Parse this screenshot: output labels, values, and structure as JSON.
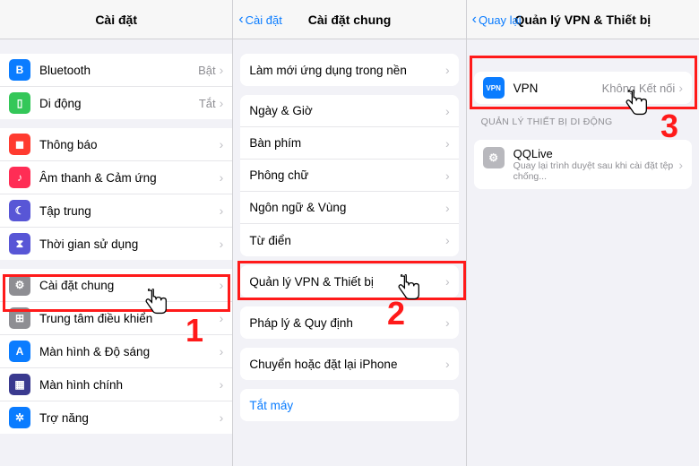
{
  "col1": {
    "title": "Cài đặt",
    "groupA": [
      {
        "name": "bluetooth",
        "label": "Bluetooth",
        "value": "Bật",
        "iconClass": "ic-bt",
        "glyph": "B"
      },
      {
        "name": "cellular",
        "label": "Di động",
        "value": "Tắt",
        "iconClass": "ic-cell",
        "glyph": "▯"
      }
    ],
    "groupB": [
      {
        "name": "notifications",
        "label": "Thông báo",
        "iconClass": "ic-notif",
        "glyph": "◼"
      },
      {
        "name": "sounds",
        "label": "Âm thanh & Cảm ứng",
        "iconClass": "ic-sound",
        "glyph": "♪"
      },
      {
        "name": "focus",
        "label": "Tập trung",
        "iconClass": "ic-focus",
        "glyph": "☾"
      },
      {
        "name": "screentime",
        "label": "Thời gian sử dụng",
        "iconClass": "ic-screentime",
        "glyph": "⧗"
      }
    ],
    "groupC": [
      {
        "name": "general",
        "label": "Cài đặt chung",
        "iconClass": "ic-general",
        "glyph": "⚙"
      },
      {
        "name": "controlcenter",
        "label": "Trung tâm điều khiển",
        "iconClass": "ic-control",
        "glyph": "⊞"
      },
      {
        "name": "display",
        "label": "Màn hình & Độ sáng",
        "iconClass": "ic-display",
        "glyph": "A"
      },
      {
        "name": "homescreen",
        "label": "Màn hình chính",
        "iconClass": "ic-home",
        "glyph": "▦"
      },
      {
        "name": "accessibility",
        "label": "Trợ năng",
        "iconClass": "ic-access",
        "glyph": "✲"
      }
    ]
  },
  "col2": {
    "back": "Cài đặt",
    "title": "Cài đặt chung",
    "g1": [
      {
        "label": "Làm mới ứng dụng trong nền"
      }
    ],
    "g2": [
      {
        "label": "Ngày & Giờ"
      },
      {
        "label": "Bàn phím"
      },
      {
        "label": "Phông chữ"
      },
      {
        "label": "Ngôn ngữ & Vùng"
      },
      {
        "label": "Từ điển"
      }
    ],
    "g3": [
      {
        "label": "Quản lý VPN & Thiết bị"
      }
    ],
    "g4": [
      {
        "label": "Pháp lý & Quy định"
      }
    ],
    "g5": [
      {
        "label": "Chuyển hoặc đặt lại iPhone"
      }
    ],
    "g6": [
      {
        "label": "Tắt máy",
        "link": true
      }
    ]
  },
  "col3": {
    "back": "Quay lại",
    "title": "Quản lý VPN & Thiết bị",
    "vpn": {
      "label": "VPN",
      "value": "Không Kết nối"
    },
    "sectionTitle": "QUẢN LÝ THIẾT BỊ DI ĐỘNG",
    "profile": {
      "label": "QQLive",
      "sub": "Quay lại trình duyệt sau khi cài đặt tệp chống..."
    }
  },
  "annotations": {
    "n1": "1",
    "n2": "2",
    "n3": "3"
  }
}
